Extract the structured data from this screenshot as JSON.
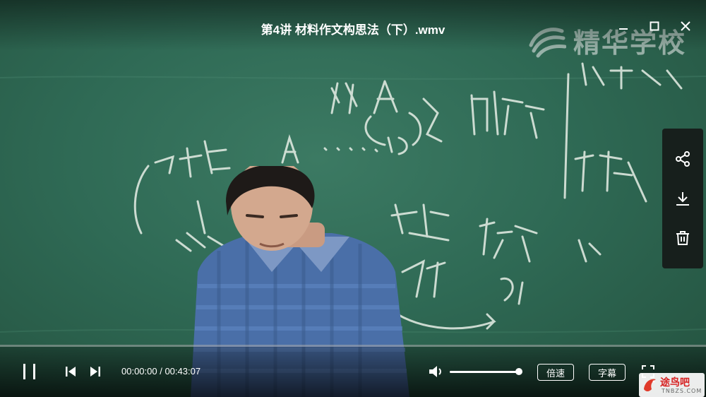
{
  "window": {
    "title": "第4讲 材料作文构思法（下）.wmv"
  },
  "video": {
    "watermark": "精华学校",
    "progress_fraction": 0.0
  },
  "side_panel": {
    "icons": [
      "share-icon",
      "download-icon",
      "trash-icon"
    ]
  },
  "controls": {
    "time_display": "00:00:00 / 00:43:07",
    "volume_fraction": 1.0,
    "speed_label": "倍速",
    "subtitle_label": "字幕"
  },
  "site_badge": {
    "name": "途鸟吧",
    "domain": "TNBZS.COM"
  }
}
